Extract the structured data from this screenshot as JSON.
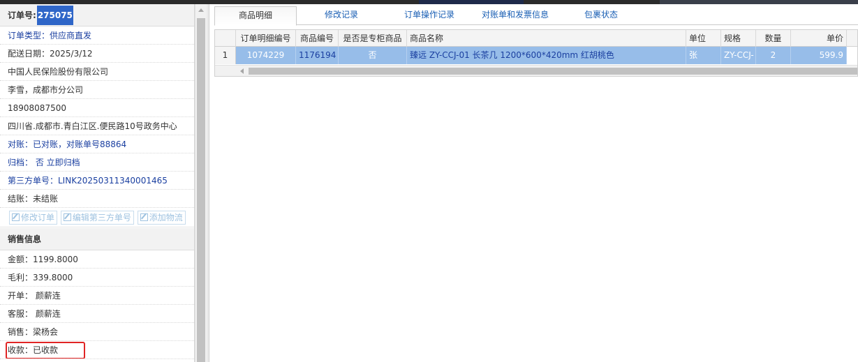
{
  "order": {
    "number_label": "订单号:",
    "number_value": "275075",
    "fields": [
      {
        "text": "订单类型：供应商直发",
        "blue": true
      },
      {
        "text": "配送日期：2025/3/12",
        "blue": false
      },
      {
        "text": "中国人民保险股份有限公司",
        "blue": false
      },
      {
        "text": "李雪，成都市分公司",
        "blue": false
      },
      {
        "text": "18908087500",
        "blue": false
      },
      {
        "text": "四川省.成都市.青白江区.便民路10号政务中心",
        "blue": false
      },
      {
        "text": "对账：已对账，对账单号88864",
        "blue": true
      },
      {
        "text": "归档：  否 立即归档",
        "blue": true
      },
      {
        "text": "第三方单号：LINK20250311340001465",
        "blue": true
      },
      {
        "text": "结账：未结账",
        "blue": false
      }
    ],
    "buttons": {
      "edit_order": "修改订单",
      "edit_third_party": "编辑第三方单号",
      "add_logistics": "添加物流"
    }
  },
  "sales": {
    "title": "销售信息",
    "amount": "金额：1199.8000",
    "profit": "毛利：339.8000",
    "issuer": "开单：  颜薪连",
    "service": "客服：  颜薪连",
    "seller": "销售：梁杨会",
    "payment": "收款：已收款"
  },
  "tabs": [
    "商品明细",
    "修改记录",
    "订单操作记录",
    "对账单和发票信息",
    "包裹状态"
  ],
  "grid": {
    "headers": [
      "订单明细编号",
      "商品编号",
      "是否是专柜商品",
      "商品名称",
      "单位",
      "规格",
      "数量",
      "单价"
    ],
    "rows": [
      {
        "row_no": "1",
        "detail_id": "1074229",
        "product_id": "1176194",
        "is_counter": "否",
        "name": "臻远 ZY-CCJ-01 长茶几 1200*600*420mm 红胡桃色",
        "unit": "张",
        "spec": "ZY-CCJ-",
        "qty": "2",
        "price": "599.9"
      }
    ]
  }
}
